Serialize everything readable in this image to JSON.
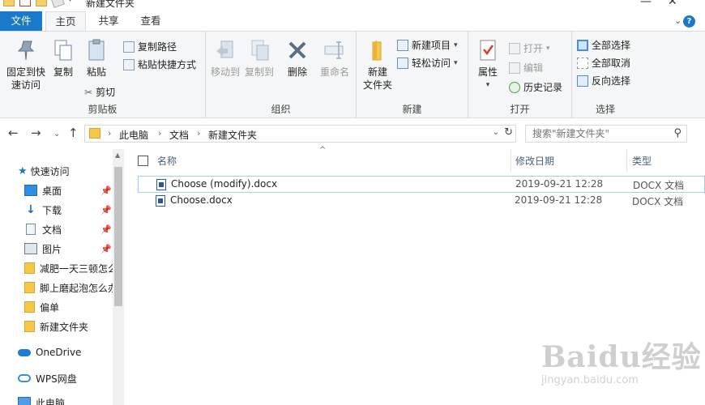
{
  "window": {
    "title": "新建文件夹"
  },
  "tabs": [
    {
      "label": "文件"
    },
    {
      "label": "主页"
    },
    {
      "label": "共享"
    },
    {
      "label": "查看"
    }
  ],
  "ribbon": {
    "clipboard": {
      "label": "剪贴板",
      "pin": "固定到快速访问",
      "pin_line1": "固定到快",
      "pin_line2": "速访问",
      "copy": "复制",
      "paste": "粘贴",
      "copy_path": "复制路径",
      "paste_shortcut": "粘贴快捷方式",
      "cut": "剪切"
    },
    "organize": {
      "label": "组织",
      "move_to": "移动到",
      "copy_to": "复制到",
      "delete": "删除",
      "rename": "重命名"
    },
    "new": {
      "label": "新建",
      "new_folder_line1": "新建",
      "new_folder_line2": "文件夹",
      "new_item": "新建项目",
      "easy_access": "轻松访问"
    },
    "open": {
      "label": "打开",
      "properties": "属性",
      "open": "打开",
      "edit": "编辑",
      "history": "历史记录"
    },
    "select": {
      "label": "选择",
      "select_all": "全部选择",
      "select_none": "全部取消",
      "invert": "反向选择"
    }
  },
  "address": {
    "crumbs": [
      "此电脑",
      "文档",
      "新建文件夹"
    ],
    "search_placeholder": "搜索\"新建文件夹\""
  },
  "nav": {
    "quick_access": "快速访问",
    "items": [
      {
        "label": "桌面",
        "pinned": true
      },
      {
        "label": "下载",
        "pinned": true
      },
      {
        "label": "文档",
        "pinned": true
      },
      {
        "label": "图片",
        "pinned": true
      },
      {
        "label": "减肥一天三顿怎么",
        "pinned": false
      },
      {
        "label": "脚上磨起泡怎么办",
        "pinned": false
      },
      {
        "label": "偏单",
        "pinned": false
      },
      {
        "label": "新建文件夹",
        "pinned": false
      }
    ],
    "onedrive": "OneDrive",
    "wps": "WPS网盘",
    "this_pc": "此电脑"
  },
  "columns": {
    "name": "名称",
    "date": "修改日期",
    "type": "类型"
  },
  "files": [
    {
      "name": "Choose (modify).docx",
      "date": "2019-09-21 12:28",
      "type": "DOCX 文档"
    },
    {
      "name": "Choose.docx",
      "date": "2019-09-21 12:28",
      "type": "DOCX 文档"
    }
  ],
  "watermark": {
    "logo": "Baidu经验",
    "url": "jingyan.baidu.com"
  },
  "colors": {
    "accent": "#1979ca",
    "selection_border": "#99d1ff",
    "ribbon_bg": "#f5f6f7"
  }
}
